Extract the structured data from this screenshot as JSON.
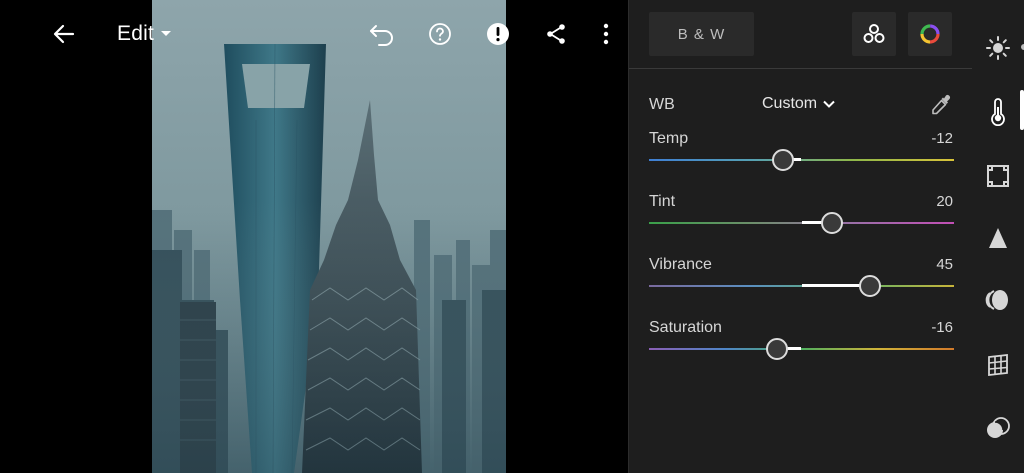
{
  "topbar": {
    "edit_label": "Edit",
    "icons": [
      "back-arrow-icon",
      "chevron-down-icon",
      "undo-icon",
      "help-icon",
      "alert-icon",
      "share-icon",
      "more-vertical-icon"
    ]
  },
  "panel": {
    "bw_label": "B & W",
    "wb": {
      "label": "WB",
      "value": "Custom"
    },
    "sliders": [
      {
        "name": "Temp",
        "value": "-12",
        "level": -12,
        "min": -100,
        "max": 100,
        "gradient": [
          "#3f7fd4",
          "#55a0b4",
          "#8fb84a",
          "#d8c33a"
        ]
      },
      {
        "name": "Tint",
        "value": "20",
        "level": 20,
        "min": -100,
        "max": 100,
        "gradient": [
          "#3aa04a",
          "#6c8f6a",
          "#9b6fa8",
          "#c24fb5"
        ]
      },
      {
        "name": "Vibrance",
        "value": "45",
        "level": 45,
        "min": -100,
        "max": 100,
        "gradient": [
          "#7a6a9e",
          "#5a8fc0",
          "#5fb56a",
          "#c7b43a"
        ]
      },
      {
        "name": "Saturation",
        "value": "-16",
        "level": -16,
        "min": -100,
        "max": 100,
        "gradient": [
          "#8b5fb5",
          "#4f86c8",
          "#4fb05f",
          "#d0b43a",
          "#d27a2a"
        ]
      }
    ]
  },
  "rail": {
    "items": [
      "light-icon",
      "color-icon",
      "effects-icon",
      "detail-icon",
      "optics-icon",
      "geometry-icon",
      "presets-icon"
    ],
    "active": "color-icon"
  },
  "colors": {
    "panel_bg": "#1e1e1e",
    "button_bg": "#2a2a2a",
    "accent": "#ffffff"
  }
}
